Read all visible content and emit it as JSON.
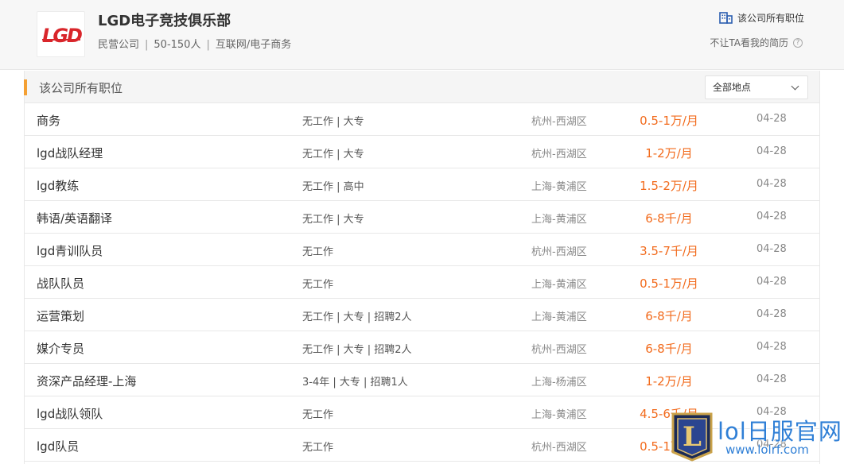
{
  "company": {
    "logo_text": "LGD",
    "name": "LGD电子竞技俱乐部",
    "type": "民营公司",
    "size": "50-150人",
    "industry": "互联网/电子商务",
    "all_jobs_link": "该公司所有职位",
    "hide_resume": "不让TA看我的简历",
    "help_symbol": "?"
  },
  "panel": {
    "title": "该公司所有职位",
    "location_filter": "全部地点"
  },
  "jobs": [
    {
      "title": "商务",
      "req": "无工作 | 大专",
      "location": "杭州-西湖区",
      "salary": "0.5-1万/月",
      "date": "04-28"
    },
    {
      "title": "lgd战队经理",
      "req": "无工作 | 大专",
      "location": "杭州-西湖区",
      "salary": "1-2万/月",
      "date": "04-28"
    },
    {
      "title": "lgd教练",
      "req": "无工作 | 高中",
      "location": "上海-黄浦区",
      "salary": "1.5-2万/月",
      "date": "04-28"
    },
    {
      "title": "韩语/英语翻译",
      "req": "无工作 | 大专",
      "location": "上海-黄浦区",
      "salary": "6-8千/月",
      "date": "04-28"
    },
    {
      "title": "lgd青训队员",
      "req": "无工作",
      "location": "杭州-西湖区",
      "salary": "3.5-7千/月",
      "date": "04-28"
    },
    {
      "title": "战队队员",
      "req": "无工作",
      "location": "上海-黄浦区",
      "salary": "0.5-1万/月",
      "date": "04-28"
    },
    {
      "title": "运营策划",
      "req": "无工作 | 大专 | 招聘2人",
      "location": "上海-黄浦区",
      "salary": "6-8千/月",
      "date": "04-28"
    },
    {
      "title": "媒介专员",
      "req": "无工作 | 大专 | 招聘2人",
      "location": "杭州-西湖区",
      "salary": "6-8千/月",
      "date": "04-28"
    },
    {
      "title": "资深产品经理-上海",
      "req": "3-4年 | 大专 | 招聘1人",
      "location": "上海-杨浦区",
      "salary": "1-2万/月",
      "date": "04-28"
    },
    {
      "title": "lgd战队领队",
      "req": "无工作",
      "location": "上海-黄浦区",
      "salary": "4.5-6千/月",
      "date": "04-28"
    },
    {
      "title": "lgd队员",
      "req": "无工作",
      "location": "杭州-西湖区",
      "salary": "0.5-1万/月",
      "date": "04-28"
    }
  ],
  "watermark": {
    "badge_letter": "L",
    "text": "lol日服官网",
    "url": "www.lolrf.com"
  },
  "colors": {
    "salary": "#f26b1d",
    "accent": "#f4a033",
    "logo_red": "#d9262b",
    "watermark_blue": "#2f7fd6"
  }
}
